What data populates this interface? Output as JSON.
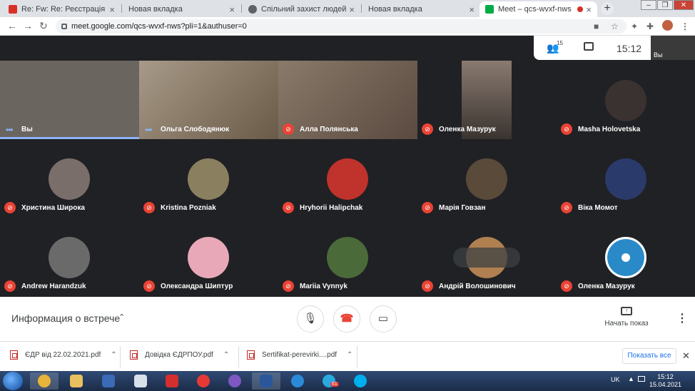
{
  "browser": {
    "tabs": [
      {
        "label": "Re: Fw: Re: Реєстрація ОКД • за",
        "color": "#d93025"
      },
      {
        "label": "Новая вкладка",
        "color": "#9aa0a6"
      },
      {
        "label": "Спільний захист людей та нав",
        "color": "#5f6368"
      },
      {
        "label": "Новая вкладка",
        "color": "#9aa0a6"
      },
      {
        "label": "Meet – qcs-wvxf-nws",
        "color": "#00ac47"
      }
    ],
    "new_tab": "+",
    "url": "meet.google.com/qcs-wvxf-nws?pli=1&authuser=0"
  },
  "meet": {
    "participants_count": "15",
    "time": "15:12",
    "self_label": "Вы",
    "tiles": [
      {
        "name": "Вы",
        "muted": false,
        "video": "#6b6560",
        "self": true
      },
      {
        "name": "Ольга Слободянюк",
        "muted": false,
        "video": "#8a7a68"
      },
      {
        "name": "Алла Полянська",
        "muted": true,
        "video": "#7a6a5a"
      },
      {
        "name": "Оленка Мазурук",
        "muted": true,
        "video": "#4a4440"
      },
      {
        "name": "Masha Holovetska",
        "muted": true,
        "avatar": "#3a3230"
      },
      {
        "name": "Христина Широка",
        "muted": true,
        "avatar": "#7a6e6a"
      },
      {
        "name": "Kristina Pozniak",
        "muted": true,
        "avatar": "#8a8060"
      },
      {
        "name": "Hryhorii Halipchak",
        "muted": true,
        "avatar": "#c0322c"
      },
      {
        "name": "Марія Говзан",
        "muted": true,
        "avatar": "#5a4a3a"
      },
      {
        "name": "Віка Момот",
        "muted": true,
        "avatar": "#2a3a6a"
      },
      {
        "name": "Andrew Harandzuk",
        "muted": true,
        "avatar": "#6a6a6a"
      },
      {
        "name": "Олександра Шиптур",
        "muted": true,
        "avatar": "#e8a8b8"
      },
      {
        "name": "Mariia Vynnyk",
        "muted": true,
        "avatar": "#4a6a3a"
      },
      {
        "name": "Андрій Волошинович",
        "muted": true,
        "avatar": "#b08050"
      },
      {
        "name": "Оленка Мазурук",
        "muted": true,
        "avatar": "#2a8ac8"
      }
    ],
    "meeting_info_label": "Информация о встрече",
    "present_label": "Начать показ",
    "colors": {
      "end_call": "#ea4335",
      "mute_badge": "#ea4335",
      "speaking": "#8ab4f8"
    }
  },
  "downloads": {
    "items": [
      "ЄДР від 22.02.2021.pdf",
      "Довідка ЄДРПОУ.pdf",
      "Sertifikat-perevirki....pdf"
    ],
    "show_all": "Показать все"
  },
  "taskbar": {
    "lang": "UK",
    "clock_time": "15:12",
    "clock_date": "15.04.2021",
    "badge": "61",
    "apps": [
      {
        "icon": "chrome-icon",
        "color": "#e8b43a"
      },
      {
        "icon": "folder-icon",
        "color": "#e8c060"
      },
      {
        "icon": "mail-icon",
        "color": "#3a6ab8"
      },
      {
        "icon": "document-icon",
        "color": "#d8e0ea"
      },
      {
        "icon": "acrobat-icon",
        "color": "#d32f2f"
      },
      {
        "icon": "opera-icon",
        "color": "#e53935"
      },
      {
        "icon": "viber-icon",
        "color": "#7e57c2"
      },
      {
        "icon": "word-icon",
        "color": "#2b579a"
      },
      {
        "icon": "edge-icon",
        "color": "#2b8ad8"
      },
      {
        "icon": "telegram-icon",
        "color": "#29a9e0"
      },
      {
        "icon": "skype-icon",
        "color": "#00aff0"
      }
    ]
  }
}
